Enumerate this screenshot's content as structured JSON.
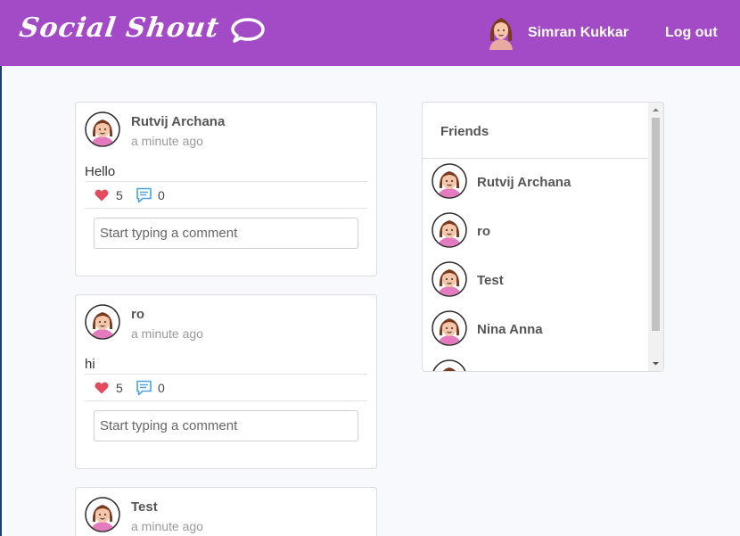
{
  "header": {
    "brand": "Social Shout",
    "user_name": "Simran Kukkar",
    "logout_label": "Log out",
    "colors": {
      "header_bg": "#a34ac7"
    }
  },
  "posts": [
    {
      "author": "Rutvij Archana",
      "time": "a minute ago",
      "content": "Hello",
      "likes": "5",
      "comments": "0",
      "comment_placeholder": "Start typing a comment"
    },
    {
      "author": "ro",
      "time": "a minute ago",
      "content": "hi",
      "likes": "5",
      "comments": "0",
      "comment_placeholder": "Start typing a comment"
    },
    {
      "author": "Test",
      "time": "a minute ago"
    }
  ],
  "friends": {
    "title": "Friends",
    "items": [
      {
        "name": "Rutvij Archana"
      },
      {
        "name": "ro"
      },
      {
        "name": "Test"
      },
      {
        "name": "Nina Anna"
      },
      {
        "name": ""
      }
    ]
  },
  "icons": {
    "logo": "chat-bubble-icon",
    "avatar": "user-avatar-icon",
    "like": "heart-icon",
    "comment": "comment-icon"
  }
}
